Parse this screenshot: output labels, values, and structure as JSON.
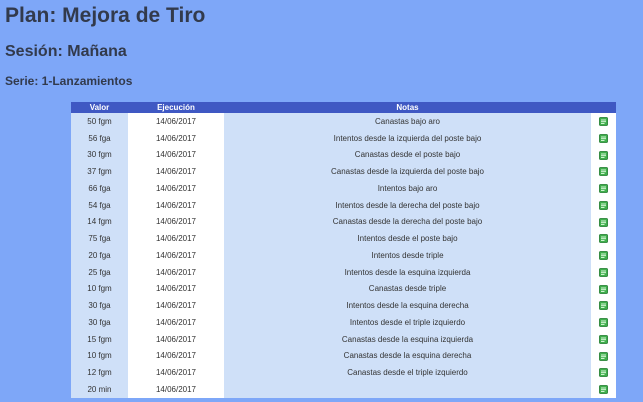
{
  "plan_title": "Plan: Mejora de Tiro",
  "session_title": "Sesión: Mañana",
  "series_title": "Serie: 1-Lanzamientos",
  "table": {
    "headers": [
      "Valor",
      "Ejecución",
      "Notas",
      ""
    ],
    "rows": [
      {
        "valor": "50 fgm",
        "fecha": "14/06/2017",
        "notas": "Canastas bajo aro",
        "icon": "edit-icon"
      },
      {
        "valor": "56 fga",
        "fecha": "14/06/2017",
        "notas": "Intentos desde la izquierda del poste bajo",
        "icon": "edit-icon"
      },
      {
        "valor": "30 fgm",
        "fecha": "14/06/2017",
        "notas": "Canastas desde el poste bajo",
        "icon": "edit-icon"
      },
      {
        "valor": "37 fgm",
        "fecha": "14/06/2017",
        "notas": "Canastas desde la izquierda del poste bajo",
        "icon": "edit-icon"
      },
      {
        "valor": "66 fga",
        "fecha": "14/06/2017",
        "notas": "Intentos bajo aro",
        "icon": "edit-icon"
      },
      {
        "valor": "54 fga",
        "fecha": "14/06/2017",
        "notas": "Intentos desde la derecha del poste bajo",
        "icon": "edit-icon"
      },
      {
        "valor": "14 fgm",
        "fecha": "14/06/2017",
        "notas": "Canastas desde la derecha del poste bajo",
        "icon": "edit-icon"
      },
      {
        "valor": "75 fga",
        "fecha": "14/06/2017",
        "notas": "Intentos desde el poste bajo",
        "icon": "edit-icon"
      },
      {
        "valor": "20 fga",
        "fecha": "14/06/2017",
        "notas": "Intentos desde triple",
        "icon": "edit-icon"
      },
      {
        "valor": "25 fga",
        "fecha": "14/06/2017",
        "notas": "Intentos desde la esquina izquierda",
        "icon": "edit-icon"
      },
      {
        "valor": "10 fgm",
        "fecha": "14/06/2017",
        "notas": "Canastas desde triple",
        "icon": "edit-icon"
      },
      {
        "valor": "30 fga",
        "fecha": "14/06/2017",
        "notas": "Intentos desde la esquina derecha",
        "icon": "edit-icon"
      },
      {
        "valor": "30 fga",
        "fecha": "14/06/2017",
        "notas": "Intentos desde el triple izquierdo",
        "icon": "edit-icon"
      },
      {
        "valor": "15 fgm",
        "fecha": "14/06/2017",
        "notas": "Canastas desde la esquina izquierda",
        "icon": "edit-icon"
      },
      {
        "valor": "10 fgm",
        "fecha": "14/06/2017",
        "notas": "Canastas desde la esquina derecha",
        "icon": "edit-icon"
      },
      {
        "valor": "12 fgm",
        "fecha": "14/06/2017",
        "notas": "Canastas desde el triple izquierdo",
        "icon": "edit-icon"
      },
      {
        "valor": "20 min",
        "fecha": "14/06/2017",
        "notas": "",
        "icon": "edit-icon"
      }
    ]
  }
}
